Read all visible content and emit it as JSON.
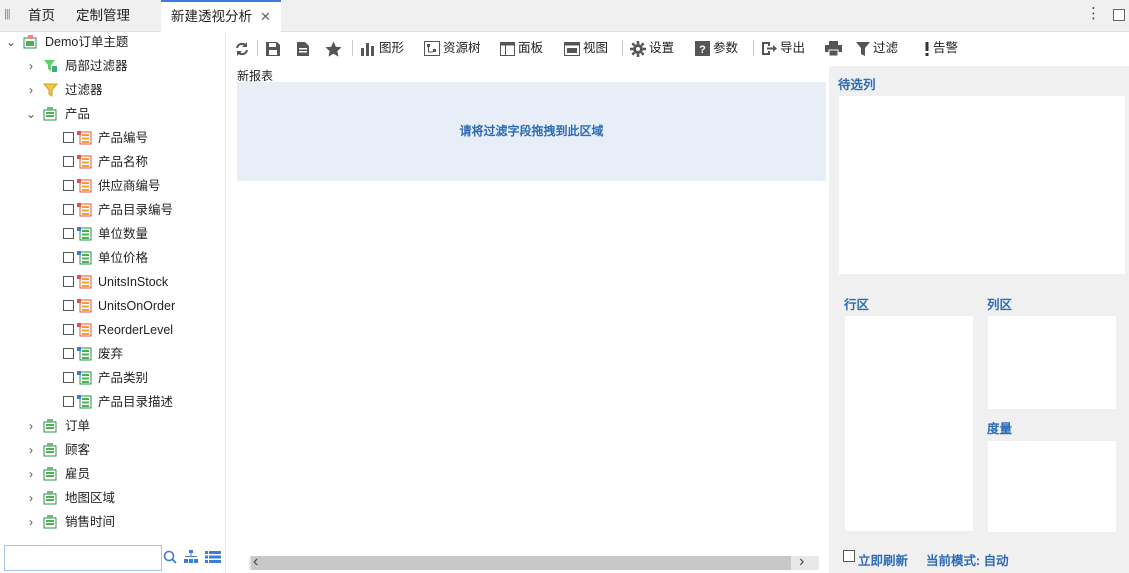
{
  "tabs": {
    "home": "首页",
    "custom": "定制管理",
    "active": "新建透视分析"
  },
  "tree": {
    "root": "Demo订单主题",
    "local_filter": "局部过滤器",
    "filter": "过滤器",
    "product": "产品",
    "fields": [
      "产品编号",
      "产品名称",
      "供应商编号",
      "产品目录编号",
      "单位数量",
      "单位价格",
      "UnitsInStock",
      "UnitsOnOrder",
      "ReorderLevel",
      "废弃",
      "产品类别",
      "产品目录描述"
    ],
    "groups": [
      "订单",
      "顾客",
      "雇员",
      "地图区域",
      "销售时间"
    ]
  },
  "toolbar": {
    "chart": "图形",
    "resource_tree": "资源树",
    "panel": "面板",
    "view": "视图",
    "settings": "设置",
    "params": "参数",
    "export": "导出",
    "filter": "过滤",
    "alert": "告警"
  },
  "main": {
    "report_title": "新报表",
    "drop_hint": "请将过滤字段拖拽到此区域"
  },
  "right": {
    "candidates": "待选列",
    "row_area": "行区",
    "col_area": "列区",
    "measure": "度量",
    "refresh_now": "立即刷新",
    "current_mode": "当前模式: 自动"
  },
  "colors": {
    "accent": "#2d6cb5",
    "drop_bg": "#e8eef8",
    "panel_bg": "#f0f0f0"
  }
}
